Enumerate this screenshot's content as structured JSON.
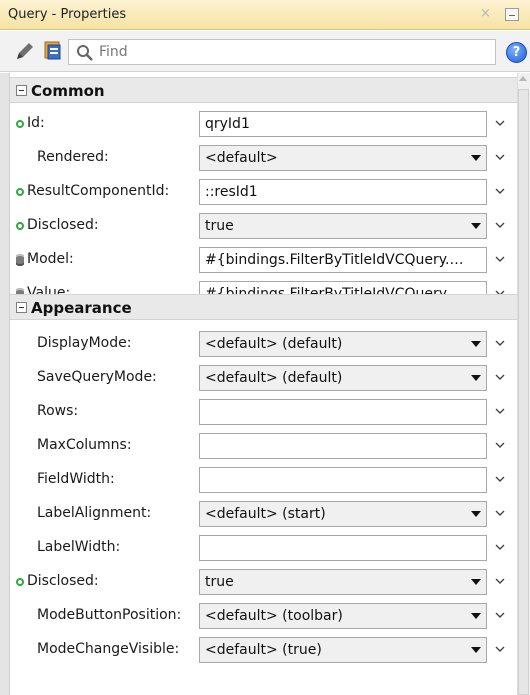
{
  "window": {
    "title": "Query - Properties",
    "close_glyph": "×"
  },
  "toolbar": {
    "find_placeholder": "Find",
    "help_glyph": "?",
    "icons": [
      "pencil-icon",
      "sheet-icon",
      "search-icon",
      "help-icon"
    ]
  },
  "sections": {
    "common": {
      "label": "Common",
      "rows": [
        {
          "name": "Id:",
          "marker": "dot",
          "value": "qryId1",
          "type": "text"
        },
        {
          "name": "Rendered:",
          "marker": "none",
          "value": "<default>",
          "type": "select"
        },
        {
          "name": "ResultComponentId:",
          "marker": "dot",
          "value": "::resId1",
          "type": "text"
        },
        {
          "name": "Disclosed:",
          "marker": "dot",
          "value": "true",
          "type": "select"
        },
        {
          "name": "Model:",
          "marker": "db",
          "value": "#{bindings.FilterByTitleIdVCQuery.…",
          "type": "text"
        },
        {
          "name": "Value:",
          "marker": "db",
          "value": "#{bindings.FilterByTitleIdVCQuery.…",
          "type": "text"
        }
      ]
    },
    "appearance": {
      "label": "Appearance",
      "rows": [
        {
          "name": "DisplayMode:",
          "marker": "none",
          "value": "<default> (default)",
          "type": "select"
        },
        {
          "name": "SaveQueryMode:",
          "marker": "none",
          "value": "<default> (default)",
          "type": "select"
        },
        {
          "name": "Rows:",
          "marker": "none",
          "value": "",
          "type": "text"
        },
        {
          "name": "MaxColumns:",
          "marker": "none",
          "value": "",
          "type": "text"
        },
        {
          "name": "FieldWidth:",
          "marker": "none",
          "value": "",
          "type": "text"
        },
        {
          "name": "LabelAlignment:",
          "marker": "none",
          "value": "<default> (start)",
          "type": "select"
        },
        {
          "name": "LabelWidth:",
          "marker": "none",
          "value": "",
          "type": "text"
        },
        {
          "name": "Disclosed:",
          "marker": "dot",
          "value": "true",
          "type": "select"
        },
        {
          "name": "ModeButtonPosition:",
          "marker": "none",
          "value": "<default> (toolbar)",
          "type": "select"
        },
        {
          "name": "ModeChangeVisible:",
          "marker": "none",
          "value": "<default> (true)",
          "type": "select"
        }
      ]
    }
  },
  "colors": {
    "title_bar": "#f6e2a2",
    "set_marker": "#2eaa3c",
    "section_bg": "#e9e9e9"
  }
}
